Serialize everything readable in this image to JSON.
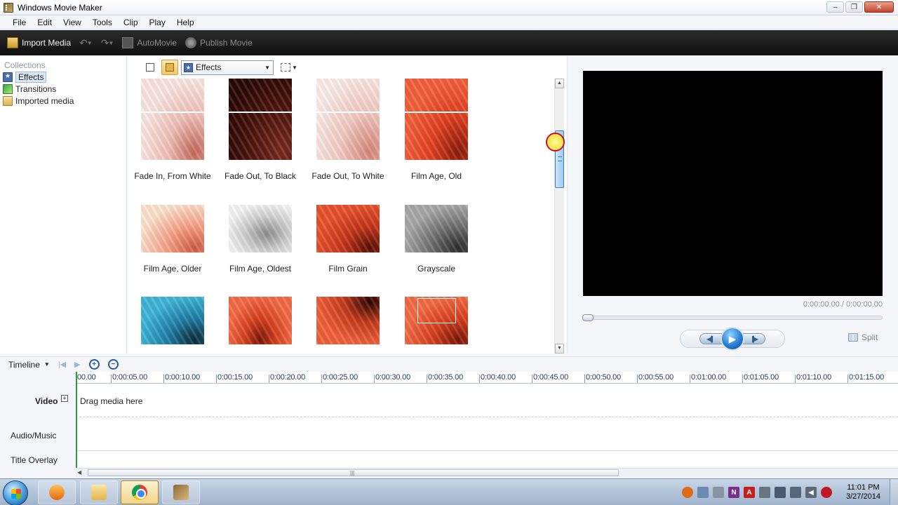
{
  "window": {
    "title": "Windows Movie Maker",
    "controls": [
      "–",
      "❐",
      "✕"
    ]
  },
  "menu": [
    "File",
    "Edit",
    "View",
    "Tools",
    "Clip",
    "Play",
    "Help"
  ],
  "toolbar": {
    "import_label": "Import Media",
    "automovie_label": "AutoMovie",
    "publish_label": "Publish Movie"
  },
  "collections": {
    "header": "Collections",
    "items": [
      {
        "label": "Effects",
        "icon": "effects-icon",
        "selected": true
      },
      {
        "label": "Transitions",
        "icon": "transitions-icon"
      },
      {
        "label": "Imported media",
        "icon": "folder-icon"
      }
    ]
  },
  "content": {
    "dropdown_value": "Effects",
    "effects": [
      {
        "caption": "Fade In, From White"
      },
      {
        "caption": "Fade Out, To Black"
      },
      {
        "caption": "Fade Out, To White"
      },
      {
        "caption": "Film Age, Old"
      },
      {
        "caption": "Film Age, Older"
      },
      {
        "caption": "Film Age, Oldest"
      },
      {
        "caption": "Film Grain"
      },
      {
        "caption": "Grayscale"
      },
      {
        "caption": ""
      },
      {
        "caption": ""
      },
      {
        "caption": ""
      },
      {
        "caption": ""
      }
    ]
  },
  "preview": {
    "timecode": "0:00:00.00 / 0:00:00.00",
    "split_label": "Split"
  },
  "timeline": {
    "label": "Timeline",
    "ticks": [
      "00.00",
      "0:00:05.00",
      "0:00:10.00",
      "0:00:15.00",
      "0:00:20.00",
      "0:00:25.00",
      "0:00:30.00",
      "0:00:35.00",
      "0:00:40.00",
      "0:00:45.00",
      "0:00:50.00",
      "0:00:55.00",
      "0:01:00.00",
      "0:01:05.00",
      "0:01:10.00",
      "0:01:15.00"
    ],
    "tracks": {
      "video": "Video",
      "audio": "Audio/Music",
      "title": "Title Overlay"
    },
    "drag_hint": "Drag media here"
  },
  "taskbar": {
    "apps": [
      "Windows Media Player",
      "Windows Explorer",
      "Google Chrome",
      "Windows Movie Maker"
    ],
    "time": "11:01 PM",
    "date": "3/27/2014"
  }
}
